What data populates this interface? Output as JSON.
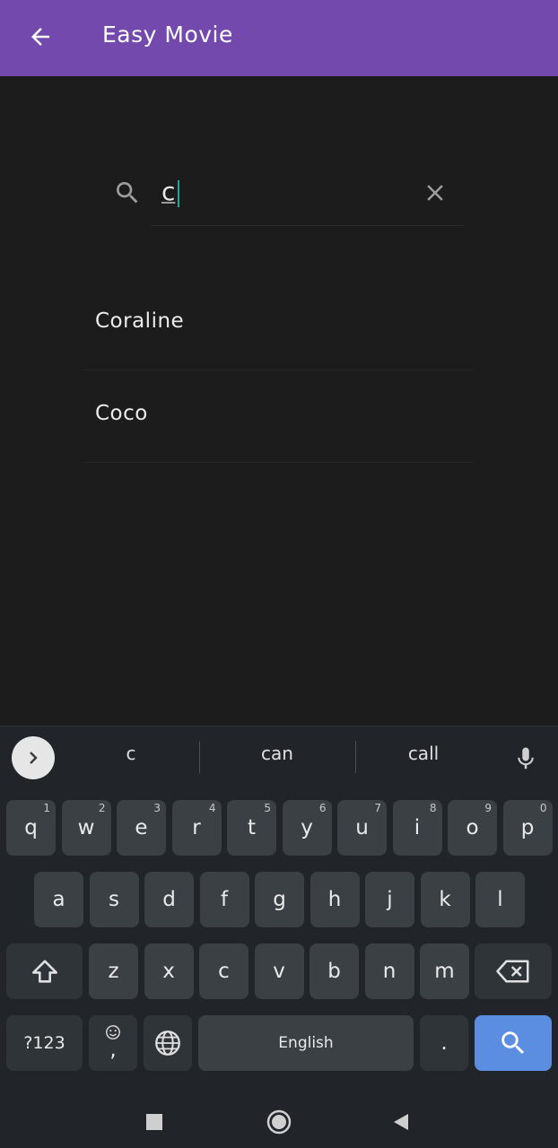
{
  "app_bar": {
    "title": "Easy Movie",
    "color": "#7349ad"
  },
  "search": {
    "query": "c"
  },
  "results": [
    {
      "title": "Coraline"
    },
    {
      "title": "Coco"
    }
  ],
  "keyboard": {
    "suggestions": [
      "c",
      "can",
      "call"
    ],
    "row1": [
      {
        "label": "q",
        "hint": "1"
      },
      {
        "label": "w",
        "hint": "2"
      },
      {
        "label": "e",
        "hint": "3"
      },
      {
        "label": "r",
        "hint": "4"
      },
      {
        "label": "t",
        "hint": "5"
      },
      {
        "label": "y",
        "hint": "6"
      },
      {
        "label": "u",
        "hint": "7"
      },
      {
        "label": "i",
        "hint": "8"
      },
      {
        "label": "o",
        "hint": "9"
      },
      {
        "label": "p",
        "hint": "0"
      }
    ],
    "row2": [
      "a",
      "s",
      "d",
      "f",
      "g",
      "h",
      "j",
      "k",
      "l"
    ],
    "row3": [
      "z",
      "x",
      "c",
      "v",
      "b",
      "n",
      "m"
    ],
    "symbols_label": "?123",
    "comma_label": ",",
    "space_label": "English",
    "period_label": ".",
    "accent_color": "#5b8ee0"
  }
}
